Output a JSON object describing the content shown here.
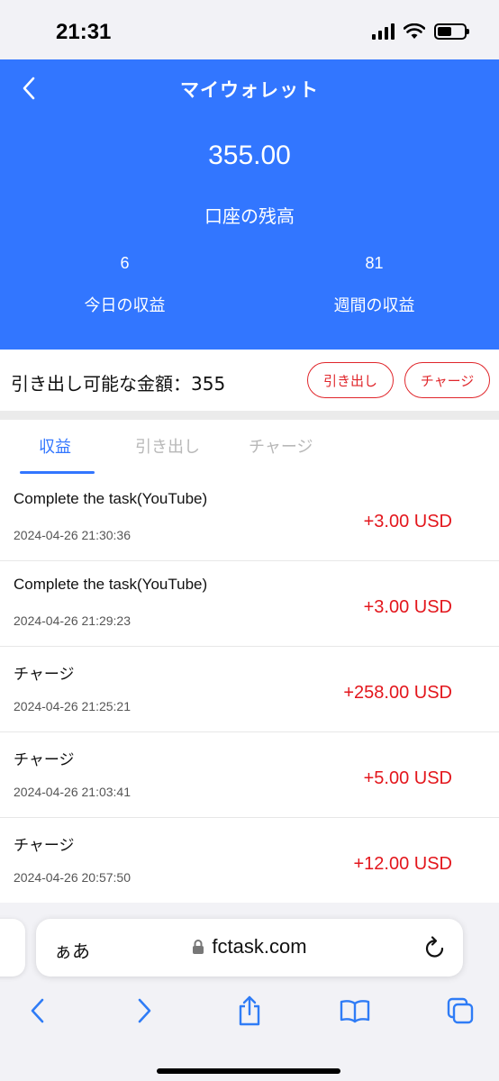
{
  "status_bar": {
    "time": "21:31"
  },
  "header": {
    "title": "マイウォレット",
    "balance": "355.00",
    "balance_label": "口座の残高",
    "today_value": "6",
    "today_label": "今日の収益",
    "week_value": "81",
    "week_label": "週間の収益",
    "bg_color": "#3276ff"
  },
  "withdrawable": {
    "text": "引き出し可能な金額：355",
    "withdraw_button": "引き出し",
    "charge_button": "チャージ",
    "accent_color": "#e0262b"
  },
  "tabs": [
    {
      "label": "収益",
      "active": true
    },
    {
      "label": "引き出し",
      "active": false
    },
    {
      "label": "チャージ",
      "active": false
    }
  ],
  "transactions": [
    {
      "title": "Complete the task(YouTube)",
      "time": "2024-04-26 21:30:36",
      "amount": "+3.00 USD"
    },
    {
      "title": "Complete the task(YouTube)",
      "time": "2024-04-26 21:29:23",
      "amount": "+3.00 USD"
    },
    {
      "title": "チャージ",
      "time": "2024-04-26 21:25:21",
      "amount": "+258.00 USD"
    },
    {
      "title": "チャージ",
      "time": "2024-04-26 21:03:41",
      "amount": "+5.00 USD"
    },
    {
      "title": "チャージ",
      "time": "2024-04-26 20:57:50",
      "amount": "+12.00 USD"
    }
  ],
  "browser": {
    "text_size_label": "ぁあ",
    "url": "fctask.com",
    "icons": [
      "back-icon",
      "forward-icon",
      "share-icon",
      "bookmarks-icon",
      "tabs-icon"
    ],
    "tint_color": "#2f7cf6"
  }
}
